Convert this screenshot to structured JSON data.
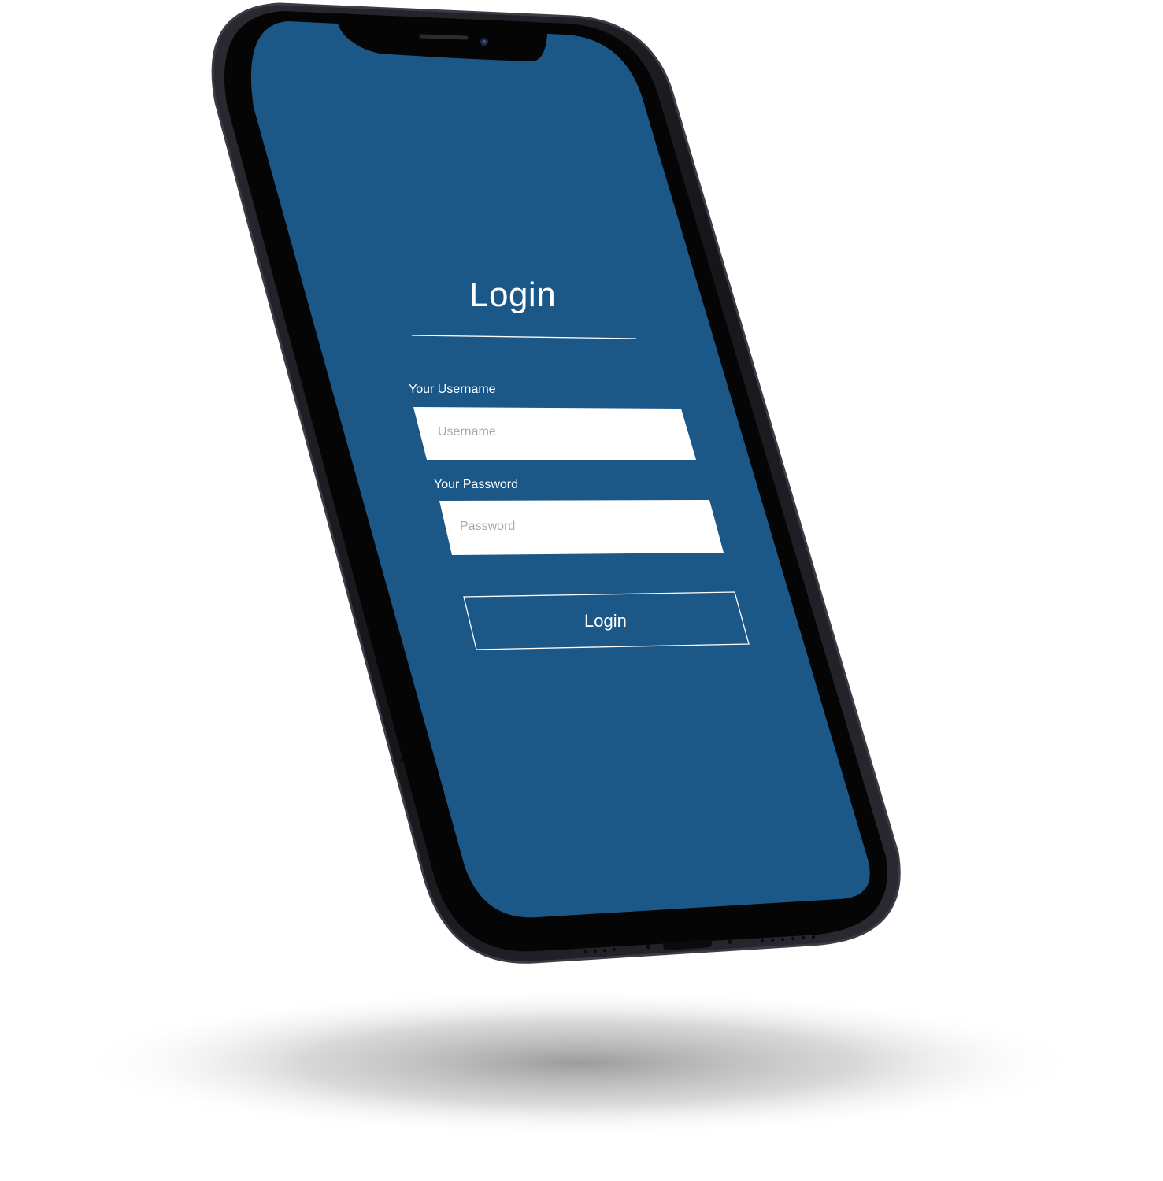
{
  "login_screen": {
    "title": "Login",
    "username": {
      "label": "Your Username",
      "placeholder": "Username",
      "value": ""
    },
    "password": {
      "label": "Your Password",
      "placeholder": "Password",
      "value": ""
    },
    "submit_label": "Login"
  },
  "colors": {
    "screen_background": "#1b5787",
    "phone_frame": "#1c1d22",
    "bezel": "#050506",
    "input_background": "#ffffff",
    "text": "#ffffff",
    "placeholder_text": "#a9a9a9"
  }
}
